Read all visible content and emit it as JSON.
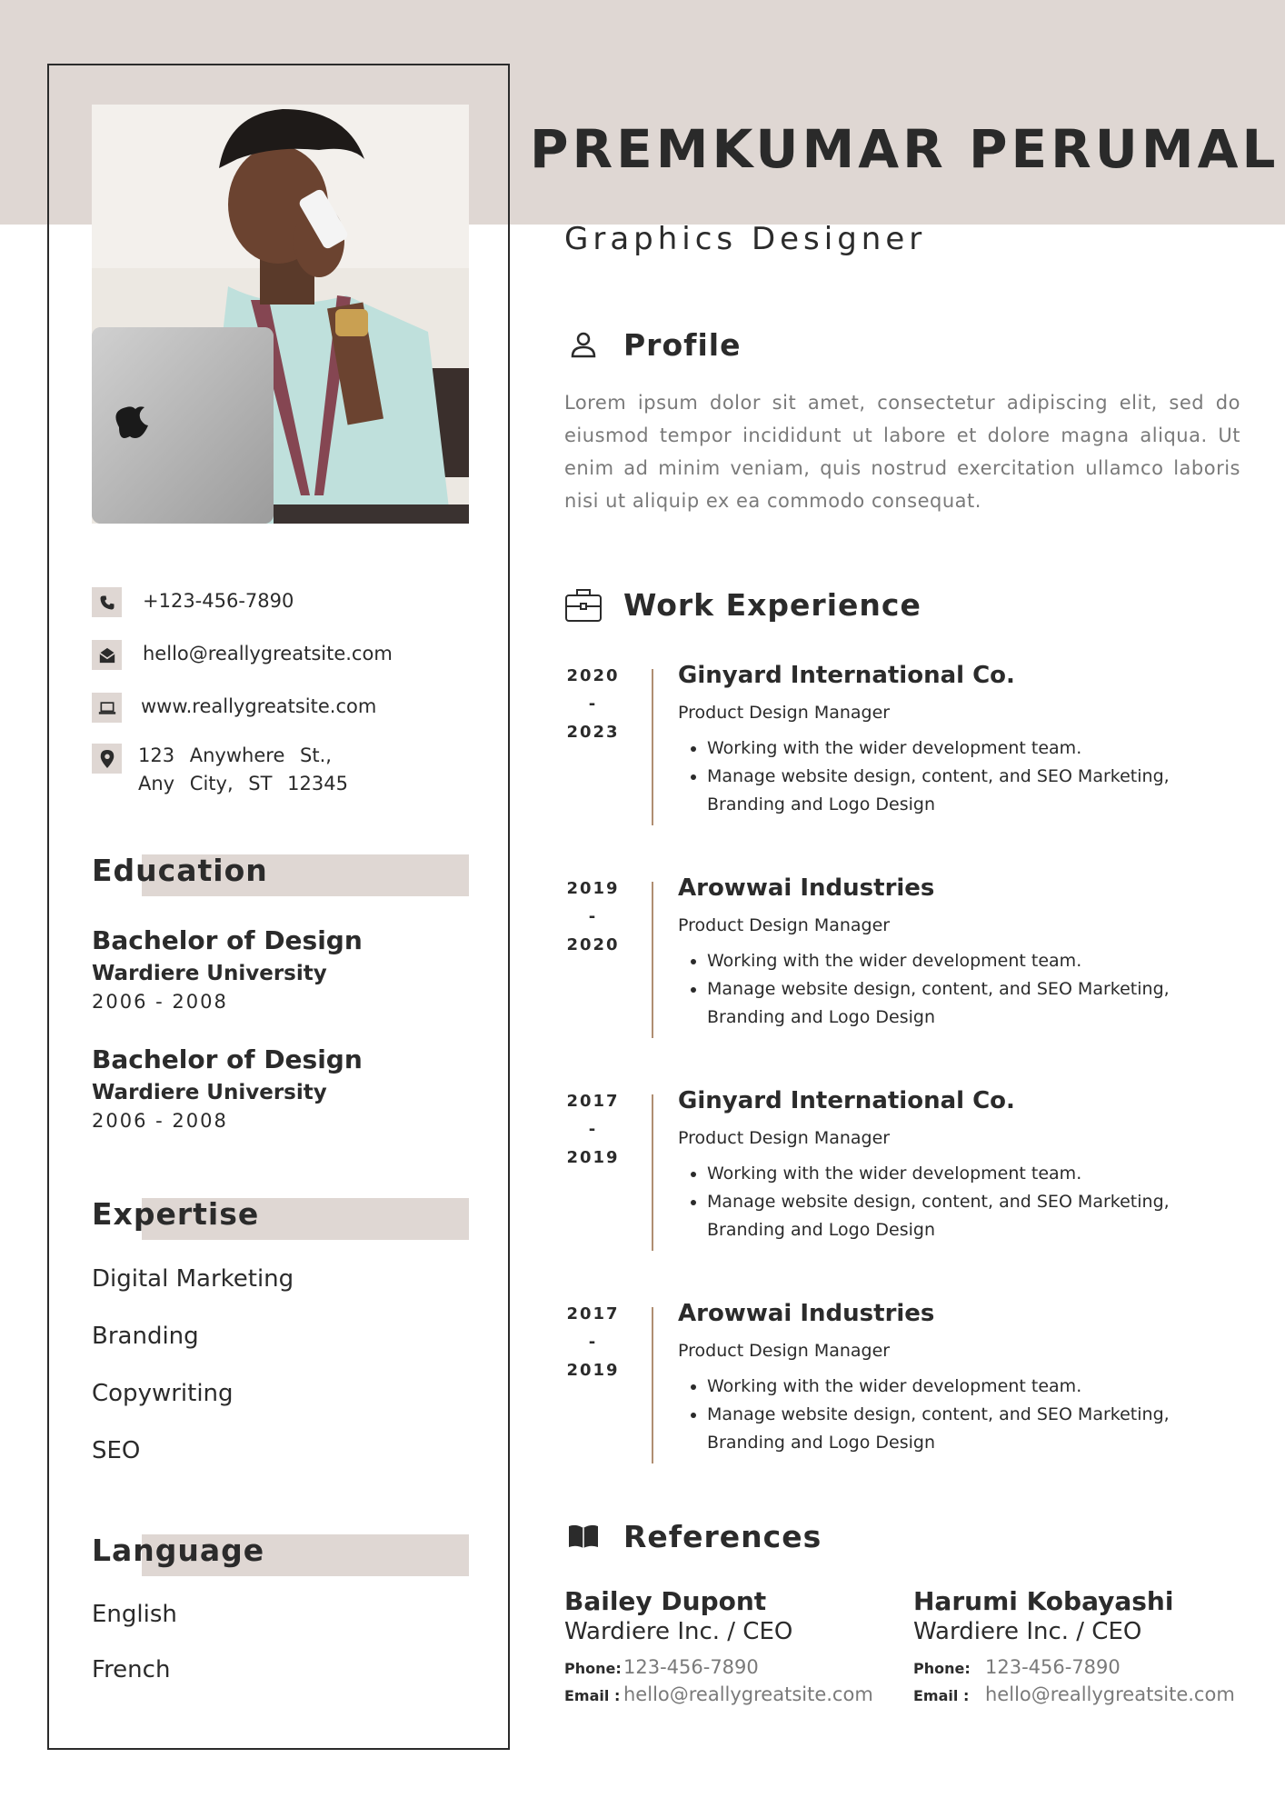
{
  "header": {
    "name": "PREMKUMAR PERUMAL",
    "role": "Graphics Designer"
  },
  "photo": {
    "alt": "profile-photo"
  },
  "contact": [
    {
      "icon": "phone-icon",
      "text": "+123-456-7890"
    },
    {
      "icon": "mail-icon",
      "text": "hello@reallygreatsite.com"
    },
    {
      "icon": "laptop-icon",
      "text": "www.reallygreatsite.com"
    },
    {
      "icon": "location-pin-icon",
      "text": "123 Anywhere St., Any City, ST 12345"
    }
  ],
  "education": {
    "heading": "Education",
    "entries": [
      {
        "degree": "Bachelor of Design",
        "school": "Wardiere University",
        "years": "2006 - 2008"
      },
      {
        "degree": "Bachelor of Design",
        "school": "Wardiere University",
        "years": "2006 - 2008"
      }
    ]
  },
  "expertise": {
    "heading": "Expertise",
    "items": [
      "Digital Marketing",
      "Branding",
      "Copywriting",
      "SEO"
    ]
  },
  "language": {
    "heading": "Language",
    "items": [
      "English",
      "French"
    ]
  },
  "profile": {
    "heading": "Profile",
    "icon": "user-icon",
    "text": "Lorem ipsum dolor sit amet, consectetur adipiscing elit, sed do eiusmod tempor incididunt ut labore et dolore magna aliqua. Ut enim ad minim veniam, quis nostrud exercitation ullamco laboris nisi ut aliquip ex ea commodo consequat."
  },
  "work": {
    "heading": "Work Experience",
    "icon": "briefcase-icon",
    "jobs": [
      {
        "start": "2020",
        "sep": "-",
        "end": "2023",
        "company": "Ginyard International Co.",
        "title": "Product Design Manager",
        "bullets": [
          "Working with the wider development team.",
          "Manage website design, content, and SEO Marketing, Branding and Logo Design"
        ]
      },
      {
        "start": "2019",
        "sep": "-",
        "end": "2020",
        "company": "Arowwai Industries",
        "title": "Product Design Manager",
        "bullets": [
          "Working with the wider development team.",
          "Manage website design, content, and SEO Marketing, Branding and Logo Design"
        ]
      },
      {
        "start": "2017",
        "sep": "-",
        "end": "2019",
        "company": "Ginyard International Co.",
        "title": "Product Design Manager",
        "bullets": [
          "Working with the wider development team.",
          "Manage website design, content, and SEO Marketing, Branding and Logo Design"
        ]
      },
      {
        "start": "2017",
        "sep": "-",
        "end": "2019",
        "company": "Arowwai Industries",
        "title": "Product Design Manager",
        "bullets": [
          "Working with the wider development team.",
          "Manage website design, content, and SEO Marketing, Branding and Logo Design"
        ]
      }
    ]
  },
  "references": {
    "heading": "References",
    "icon": "open-book-icon",
    "people": [
      {
        "name": "Bailey Dupont",
        "company": "Wardiere Inc. / CEO",
        "phone_label": "Phone:",
        "phone": "123-456-7890",
        "email_label": "Email :",
        "email": "hello@reallygreatsite.com"
      },
      {
        "name": "Harumi Kobayashi",
        "company": "Wardiere Inc. / CEO",
        "phone_label": "Phone:",
        "phone": "123-456-7890",
        "email_label": "Email :",
        "email": "hello@reallygreatsite.com"
      }
    ]
  },
  "colors": {
    "accent_band": "#dfd7d3",
    "timeline_line": "#b08e72",
    "text_dark": "#2b2b2b",
    "text_muted": "#7a7a7a"
  }
}
